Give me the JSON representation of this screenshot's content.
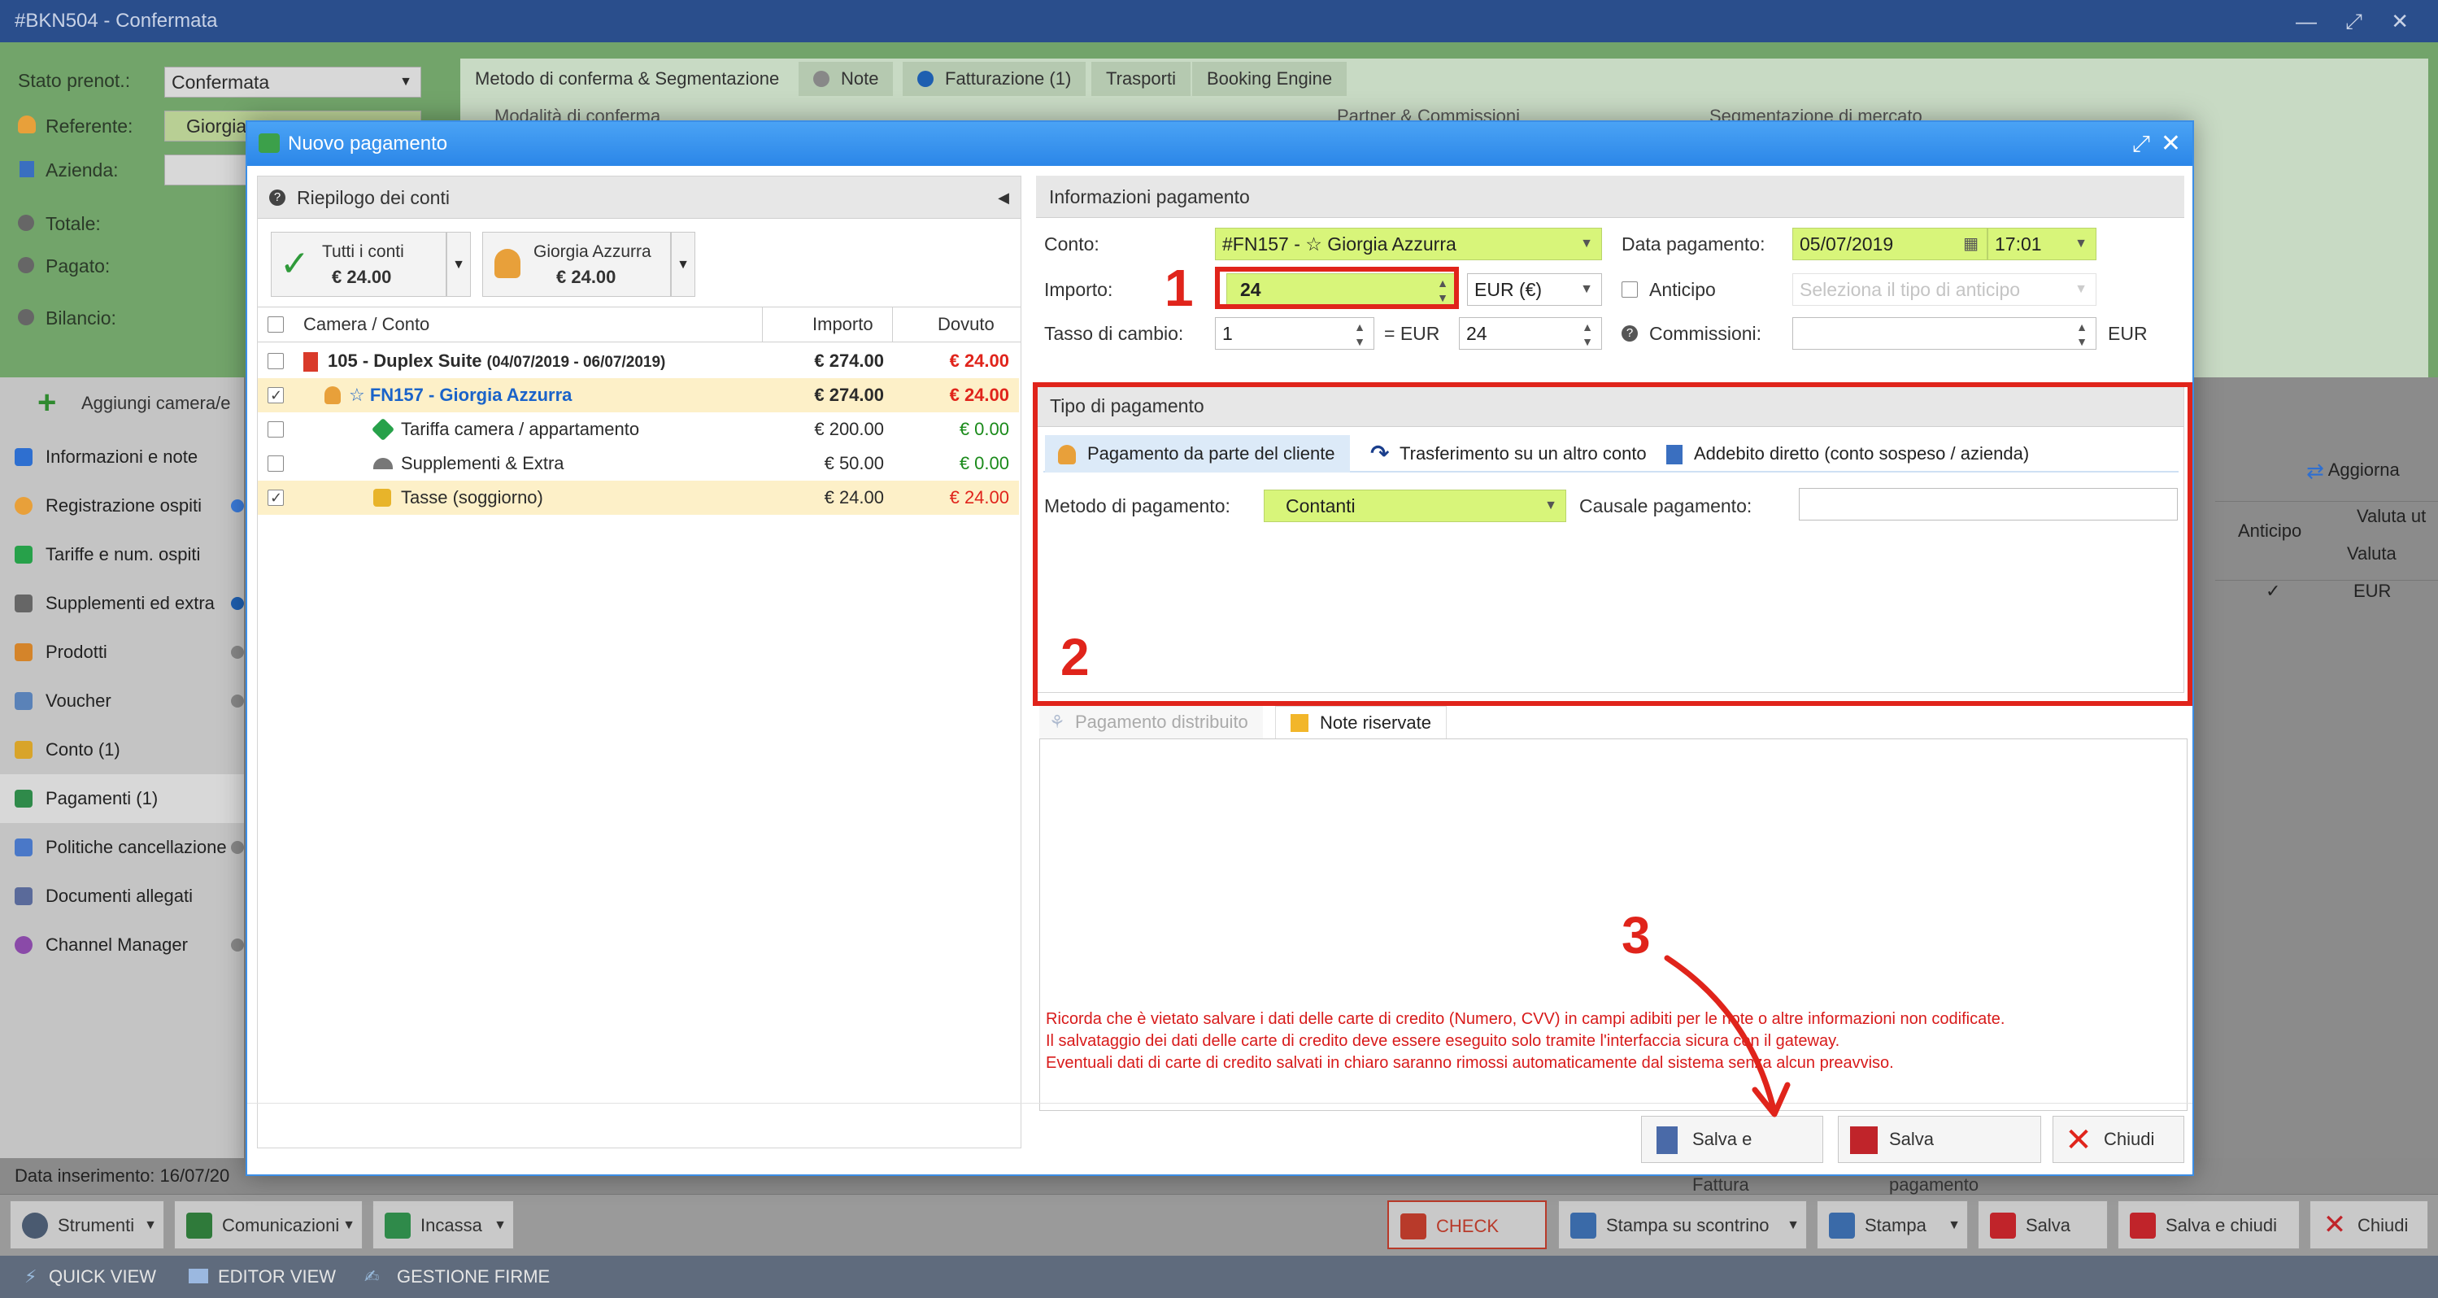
{
  "window": {
    "title": "#BKN504 - Confermata",
    "controls": "— ⤢ ✕"
  },
  "background": {
    "stato_label": "Stato prenot.:",
    "stato_value": "Confermata",
    "referente_label": "Referente:",
    "referente_value": "Giorgia",
    "azienda_label": "Azienda:",
    "totale_label": "Totale:",
    "pagato_label": "Pagato:",
    "bilancio_label": "Bilancio:",
    "tabs": [
      "Metodo di conferma & Segmentazione",
      "Note",
      "Fatturazione (1)",
      "Trasporti",
      "Booking Engine"
    ],
    "section_labels": [
      "Modalità di conferma",
      "Partner & Commissioni",
      "Segmentazione di mercato"
    ],
    "add_room": "Aggiungi camera/e",
    "nav": [
      "Informazioni e note",
      "Registrazione ospiti",
      "Tariffe e num. ospiti",
      "Supplementi ed extra",
      "Prodotti",
      "Voucher",
      "Conto (1)",
      "Pagamenti (1)",
      "Politiche cancellazione",
      "Documenti allegati",
      "Channel Manager"
    ],
    "aggiorna": "Aggiorna",
    "grid_headers": {
      "anticipo": "Anticipo",
      "valuta_ut": "Valuta ut",
      "valuta": "Valuta"
    },
    "grid_row": {
      "check": "✓",
      "currency": "EUR"
    },
    "data_inserimento_label": "Data inserimento:",
    "data_inserimento_value": "16/07/20",
    "toolbar": {
      "strumenti": "Strumenti",
      "comunicazioni": "Comunicazioni",
      "incassa": "Incassa",
      "check_out": "CHECK OUT",
      "stampa_scontrino": "Stampa su scontrino",
      "stampa": "Stampa",
      "salva": "Salva",
      "salva_chiudi": "Salva e chiudi",
      "chiudi": "Chiudi"
    },
    "status": {
      "quick_view": "QUICK VIEW",
      "editor_view": "EDITOR VIEW",
      "gestione_firme": "GESTIONE FIRME"
    }
  },
  "modal": {
    "title": "Nuovo pagamento",
    "left": {
      "header": "Riepilogo dei conti",
      "card_all": {
        "label": "Tutti i conti",
        "amount": "€ 24.00"
      },
      "card_guest": {
        "label": "Giorgia Azzurra",
        "amount": "€ 24.00"
      },
      "columns": {
        "camera": "Camera / Conto",
        "importo": "Importo",
        "dovuto": "Dovuto"
      },
      "rows": [
        {
          "name": "105 - Duplex Suite",
          "sub": "(04/07/2019 - 06/07/2019)",
          "importo": "€ 274.00",
          "dovuto": "€ 24.00"
        },
        {
          "name": "☆ FN157 - Giorgia Azzurra",
          "importo": "€ 274.00",
          "dovuto": "€ 24.00"
        },
        {
          "name": "Tariffa camera / appartamento",
          "importo": "€ 200.00",
          "dovuto": "€ 0.00"
        },
        {
          "name": "Supplementi & Extra",
          "importo": "€ 50.00",
          "dovuto": "€ 0.00"
        },
        {
          "name": "Tasse (soggiorno)",
          "importo": "€ 24.00",
          "dovuto": "€ 24.00"
        }
      ]
    },
    "info": {
      "header": "Informazioni pagamento",
      "conto_label": "Conto:",
      "conto_value": "#FN157 - ☆ Giorgia Azzurra",
      "importo_label": "Importo:",
      "importo_value": "24",
      "currency_value": "EUR (€)",
      "tasso_label": "Tasso di cambio:",
      "tasso_value": "1",
      "eq_eur": "= EUR",
      "tasso_result": "24",
      "data_label": "Data pagamento:",
      "data_value": "05/07/2019",
      "ora_value": "17:01",
      "anticipo_label": "Anticipo",
      "anticipo_placeholder": "Seleziona il tipo di anticipo",
      "commissioni_label": "Commissioni:",
      "commissioni_currency": "EUR"
    },
    "tipo": {
      "header": "Tipo di pagamento",
      "tabs": [
        "Pagamento da parte del cliente",
        "Trasferimento su un altro conto",
        "Addebito diretto (conto sospeso / azienda)"
      ],
      "metodo_label": "Metodo di pagamento:",
      "metodo_value": "Contanti",
      "causale_label": "Causale pagamento:"
    },
    "subtabs": [
      "Pagamento distribuito",
      "Note riservate"
    ],
    "warning": [
      "Ricorda che è vietato salvare i dati delle carte di credito (Numero, CVV) in campi adibiti per le note o altre informazioni non codificate.",
      "Il salvataggio dei dati delle carte di credito deve essere eseguito solo tramite l'interfaccia sicura con il gateway.",
      "Eventuali dati di carte di credito salvati in chiaro saranno rimossi automaticamente dal sistema senza alcun preavviso."
    ],
    "buttons": {
      "salva_fattura": "Salva e Fattura",
      "salva_pagamento": "Salva pagamento",
      "chiudi": "Chiudi"
    }
  },
  "annotations": {
    "n1": "1",
    "n2": "2",
    "n3": "3"
  },
  "colors": {
    "accent_blue": "#2b86e8",
    "field_green": "#d8f57a",
    "alert_red": "#e0241b",
    "amount_blue": "#1a63c9",
    "ok_green": "#1a8a1a"
  }
}
